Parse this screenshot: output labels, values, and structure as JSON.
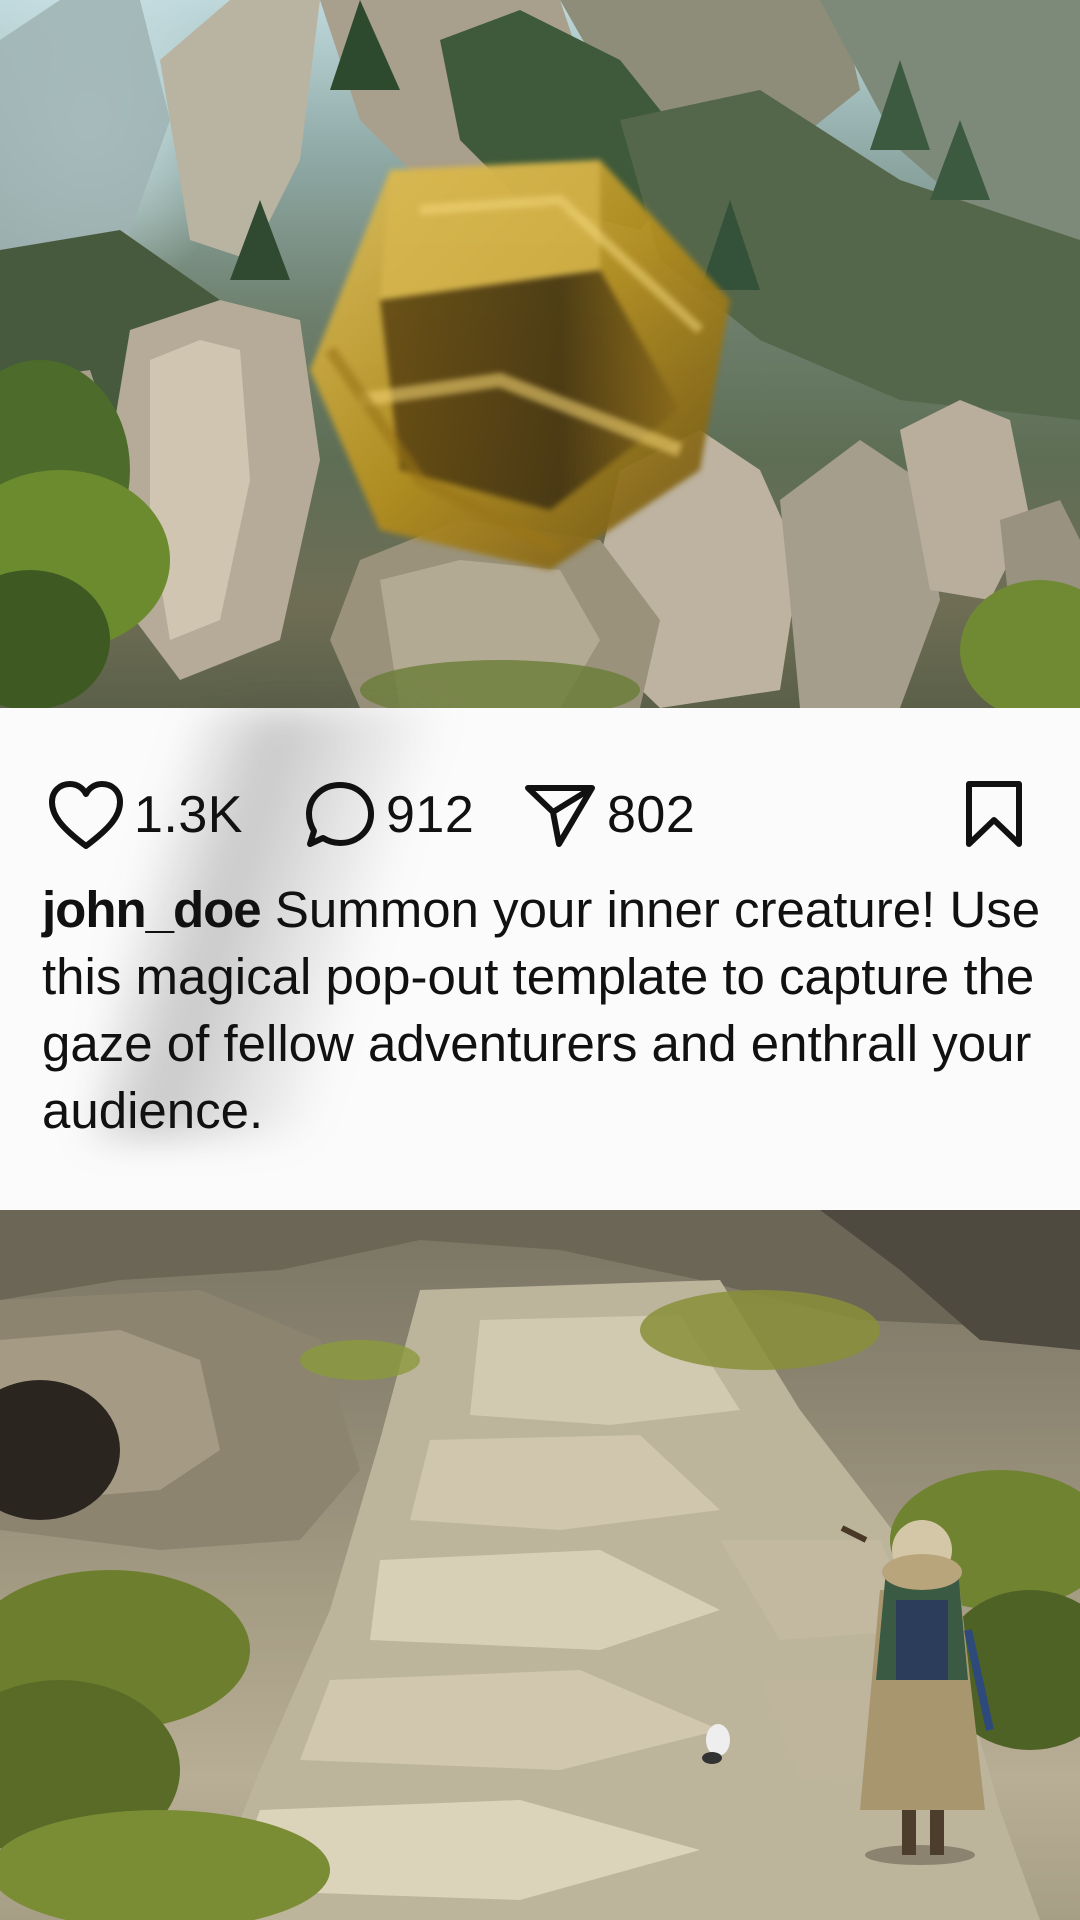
{
  "post": {
    "top_image_icon": "fantasy-mountain-scene",
    "bottom_image_icon": "stone-path-adventurer-scene",
    "likes": "1.3K",
    "comments": "912",
    "shares": "802",
    "username": "john_doe",
    "caption": " Summon your inner creature! Use this magical pop-out template to capture the gaze of fellow adventurers and enthrall your audience."
  },
  "icons": {
    "like": "heart-icon",
    "comment": "comment-bubble-icon",
    "share": "paper-plane-icon",
    "save": "bookmark-icon"
  },
  "colors": {
    "panel_background": "#fbfbfb",
    "text": "#111111",
    "die_gold": "#c9a227"
  }
}
